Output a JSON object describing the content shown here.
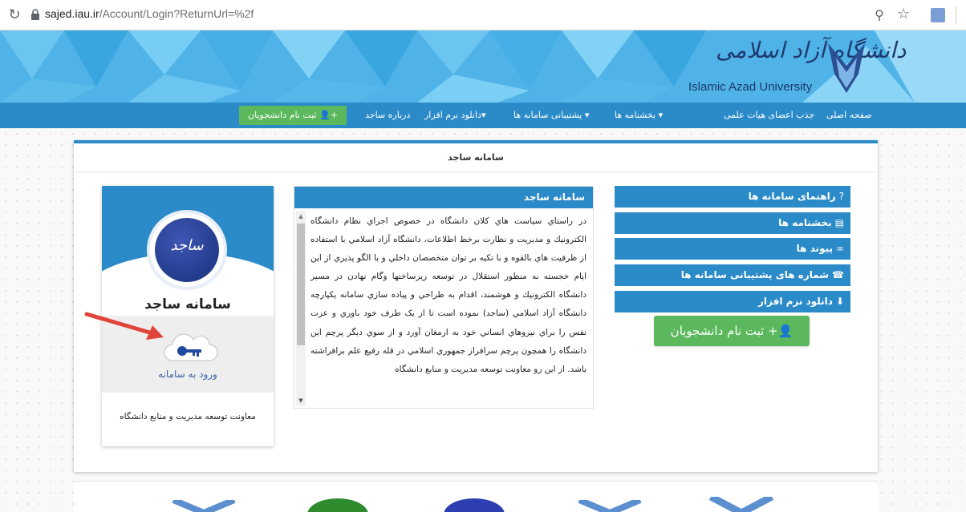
{
  "browser": {
    "url_host": "sajed.iau.ir",
    "url_path": "/Account/Login?ReturnUrl=%2f"
  },
  "header": {
    "logo_script": "دانشگاه آزاد اسلامی",
    "logo_en": "Islamic Azad University"
  },
  "nav": {
    "items": [
      {
        "label": "صفحه اصلی"
      },
      {
        "label": "جذب اعضای هیات علمی"
      },
      {
        "label": "بخشنامه ها ▾"
      },
      {
        "label": "پشتیبانی سامانه ها ▾"
      },
      {
        "label": "دانلود نرم افزار▾"
      },
      {
        "label": "درباره ساجد"
      }
    ],
    "signup_label": "ثبت نام دانشجویان"
  },
  "card": {
    "title": "سامانه ساجد"
  },
  "menu": {
    "items": [
      {
        "label": "راهنمای سامانه ها",
        "icon": "question-icon"
      },
      {
        "label": "بخشنامه ها",
        "icon": "pdf-icon"
      },
      {
        "label": "پیوند ها",
        "icon": "link-icon"
      },
      {
        "label": "شماره های پشتیبانی سامانه ها",
        "icon": "phone-icon"
      },
      {
        "label": "دانلود نرم افزار",
        "icon": "download-icon"
      }
    ],
    "signup_label": "ثبت نام دانشجویان"
  },
  "article": {
    "heading": "سامانه ساجد",
    "body": "در راستاي سياست هاي كلان دانشگاه در خصوص اجراي نظام دانشگاه الكترونيك و مديريت و نظارت برخط اطلاعات، دانشگاه آزاد اسلامي با استفاده از ظرفيت هاي بالقوه و با تكيه بر توان متخصصان داخلي و با الگو پذيري از اين ايام خجسته به منظور استقلال در توسعه زيرساختها وگام نهادن در مسير دانشگاه الكترونيك و هوشمند، اقدام به طراحي و پياده سازي سامانه يكپارچه دانشگاه آزاد اسلامي (ساجد) نموده است تا از يک طرف خود باوري و عزت نفس را براي نيروهاي انساني خود به ارمغان آورد و از سوي ديگر پرچم اين دانشگاه را همچون پرچم سرافراز جمهوري اسلامي در قله رفيع علم برافراشته باشد. از اين رو معاونت توسعه مديريت و منابع دانشگاه"
  },
  "login_card": {
    "seal_text": "ساجد",
    "title": "سامانه ساجد",
    "login_label": "ورود به سامانه",
    "footer": "معاونت توسعه مدیریت و منابع دانشگاه"
  },
  "colors": {
    "primary": "#2b8bc8",
    "success": "#5cb85c",
    "banner": "#4fb3e8"
  }
}
